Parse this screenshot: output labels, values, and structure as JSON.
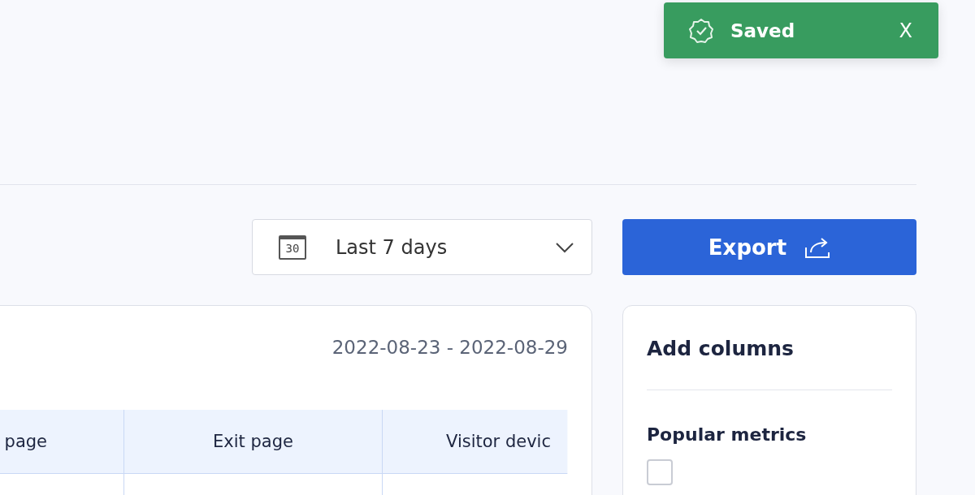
{
  "toast": {
    "message": "Saved",
    "close": "X"
  },
  "toolbar": {
    "date_range": {
      "value": "Last 7 days",
      "calendar_day": "30"
    },
    "export_button": "Export"
  },
  "report_card": {
    "date_range": "2022-08-23 - 2022-08-29",
    "table": {
      "columns": [
        "page",
        "Exit page",
        "Visitor devic"
      ]
    }
  },
  "columns_panel": {
    "title": "Add columns",
    "section": "Popular metrics",
    "checkboxes": [
      {
        "checked": false
      }
    ]
  }
}
